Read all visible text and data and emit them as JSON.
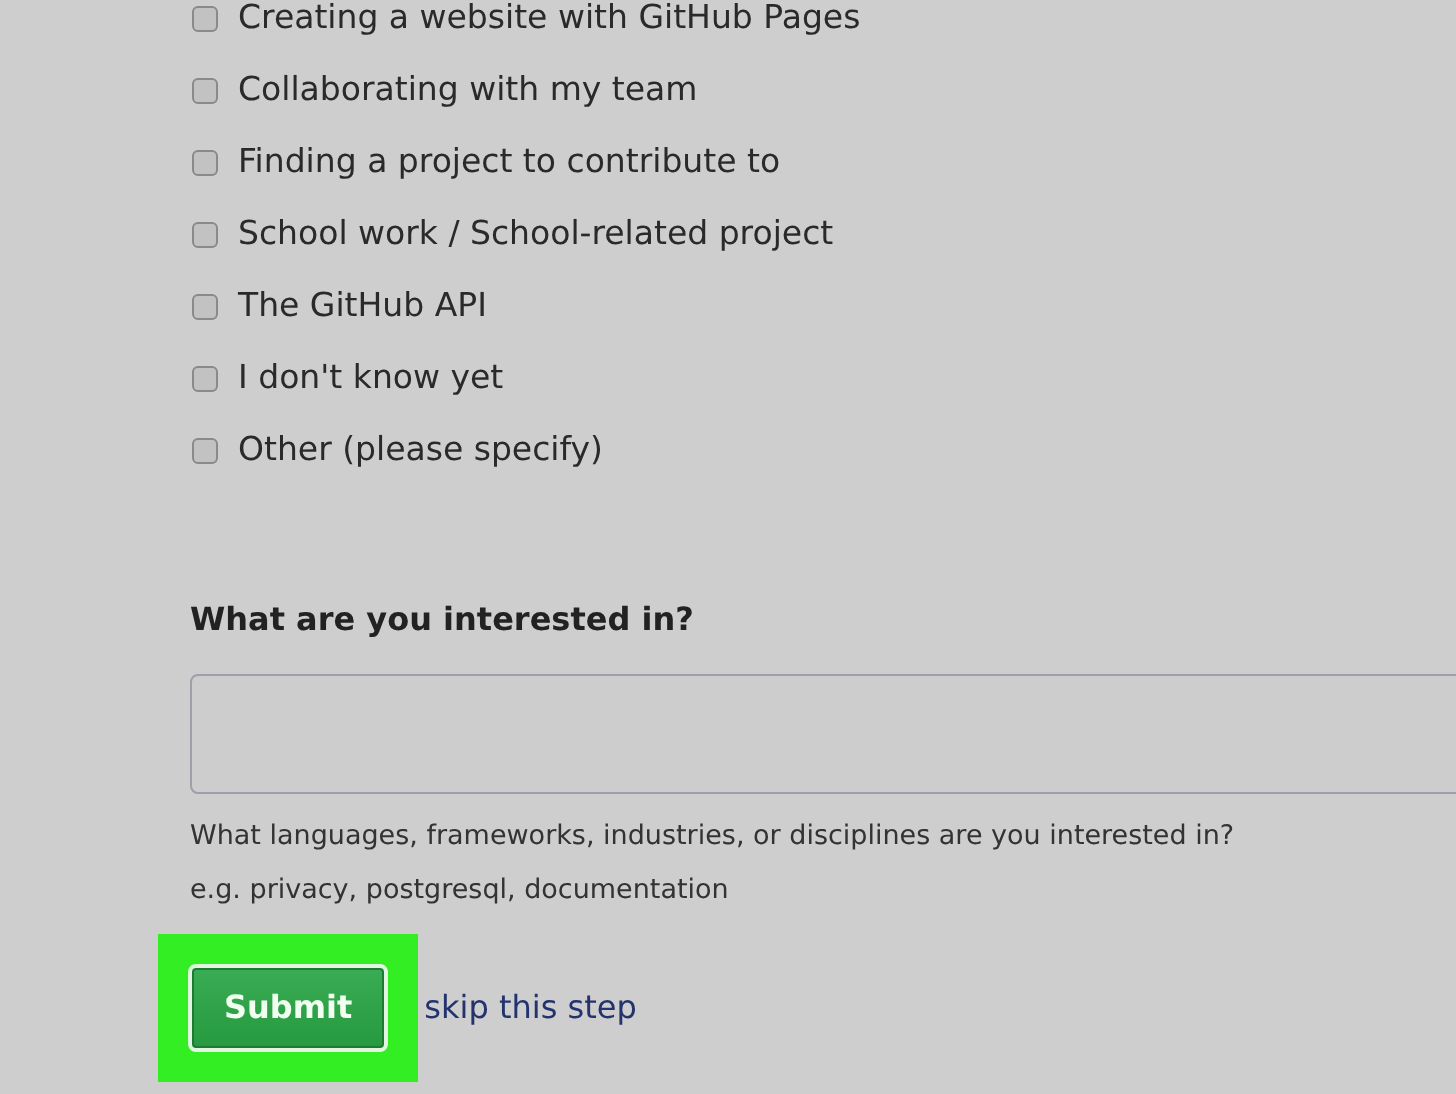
{
  "options": [
    {
      "label": "Creating a website with GitHub Pages",
      "checked": false
    },
    {
      "label": "Collaborating with my team",
      "checked": false
    },
    {
      "label": "Finding a project to contribute to",
      "checked": false
    },
    {
      "label": "School work / School-related project",
      "checked": false
    },
    {
      "label": "The GitHub API",
      "checked": false
    },
    {
      "label": "I don't know yet",
      "checked": false
    },
    {
      "label": "Other (please specify)",
      "checked": false
    }
  ],
  "interests": {
    "label": "What are you interested in?",
    "help": "What languages, frameworks, industries, or disciplines are you interested in?",
    "example": "e.g. privacy, postgresql, documentation"
  },
  "submit": {
    "label": "Submit",
    "highlighted": true
  },
  "skip_link": "skip this step"
}
